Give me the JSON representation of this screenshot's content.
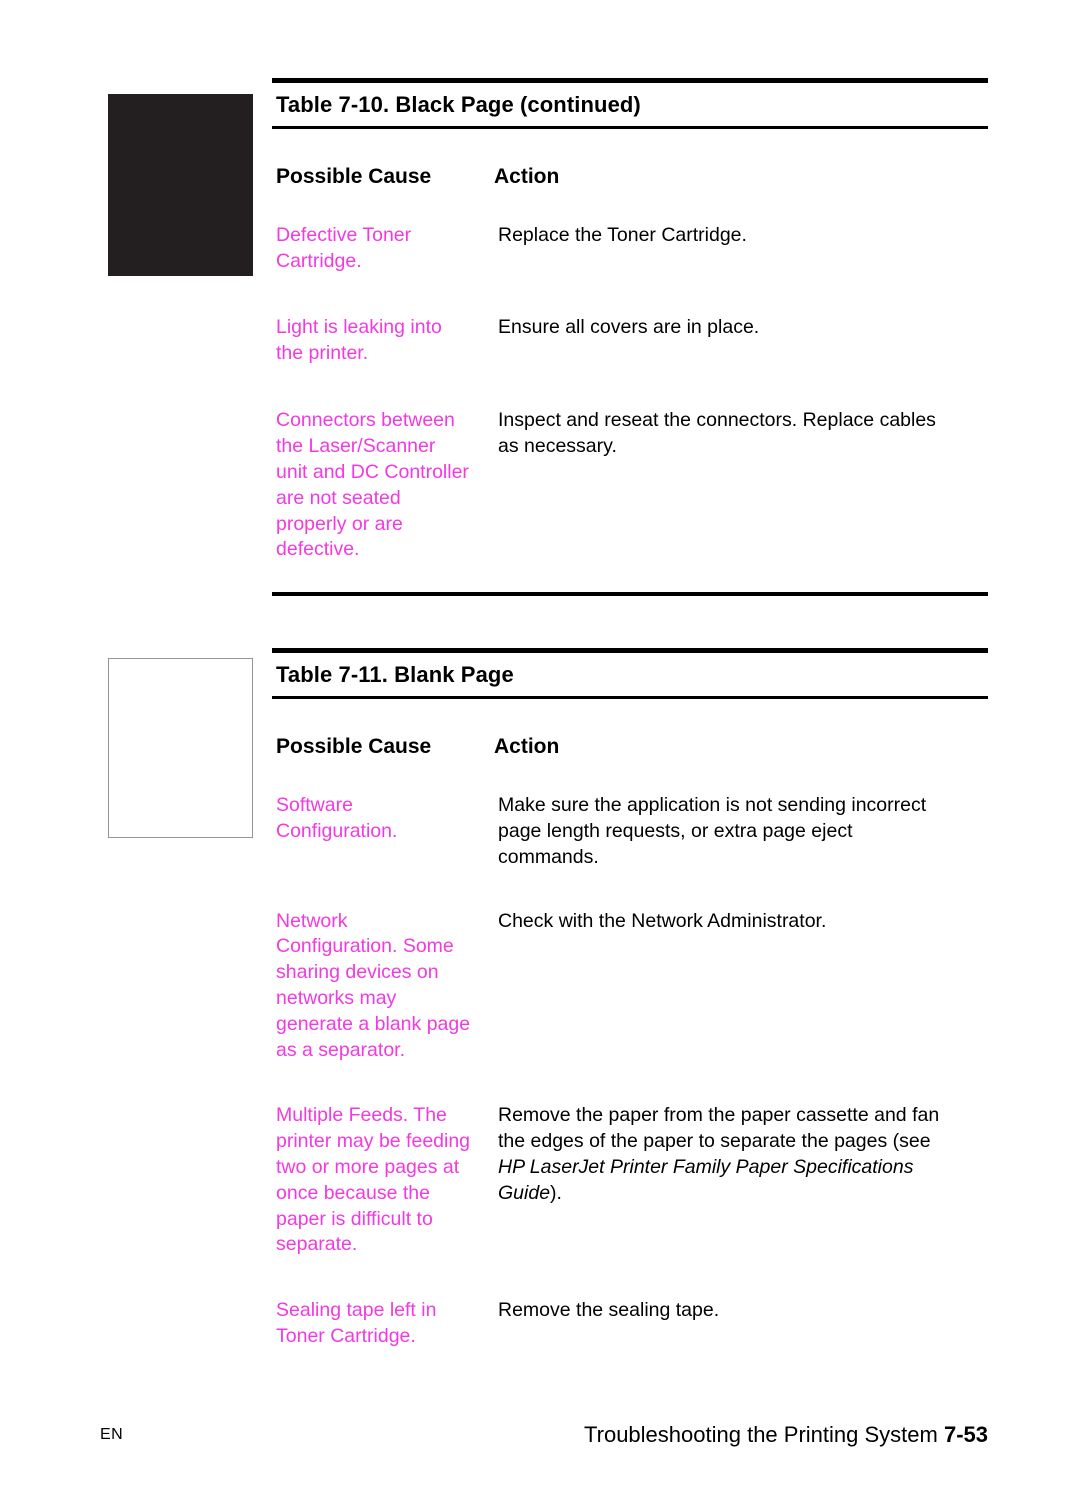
{
  "document": {
    "column_headers": {
      "cause": "Possible Cause",
      "action": "Action"
    },
    "accent_color": "#f23ae0",
    "text_color": "#000000"
  },
  "tables": [
    {
      "caption": "Table 7-10. Black Page (continued)",
      "figure": "black-page-illustration",
      "rows": [
        {
          "cause": "Defective Toner\nCartridge.",
          "action": "Replace the Toner Cartridge."
        },
        {
          "cause": "Light is leaking into\nthe printer.",
          "action": "Ensure all covers are in place."
        },
        {
          "cause": "Connectors between\nthe Laser/Scanner\nunit and DC Controller\nare not seated\nproperly or are\ndefective.",
          "action": "Inspect and reseat the connectors. Replace cables\nas necessary."
        }
      ]
    },
    {
      "caption": "Table 7-11. Blank Page",
      "figure": "blank-page-illustration",
      "rows": [
        {
          "cause": "Software\nConfiguration.",
          "action": "Make sure the application is not sending incorrect\npage length requests, or extra page eject\ncommands."
        },
        {
          "cause": "Network\nConfiguration. Some\nsharing devices on\nnetworks may\ngenerate a blank page\nas a separator.",
          "action": "Check with the Network Administrator."
        },
        {
          "cause": "Multiple Feeds. The\nprinter may be feeding\ntwo or more pages at\nonce because the\npaper is difficult to\nseparate.",
          "action_before": "Remove the paper from the paper cassette and fan\nthe edges of the paper to separate the pages (see\n",
          "action_italic": "HP LaserJet Printer Family Paper Specifications\nGuide",
          "action_after": ")."
        },
        {
          "cause": "Sealing tape left in\nToner Cartridge.",
          "action": "Remove the sealing tape."
        }
      ]
    }
  ],
  "footer": {
    "language": "EN",
    "title": "Troubleshooting the Printing System ",
    "page_number": "7-53"
  }
}
